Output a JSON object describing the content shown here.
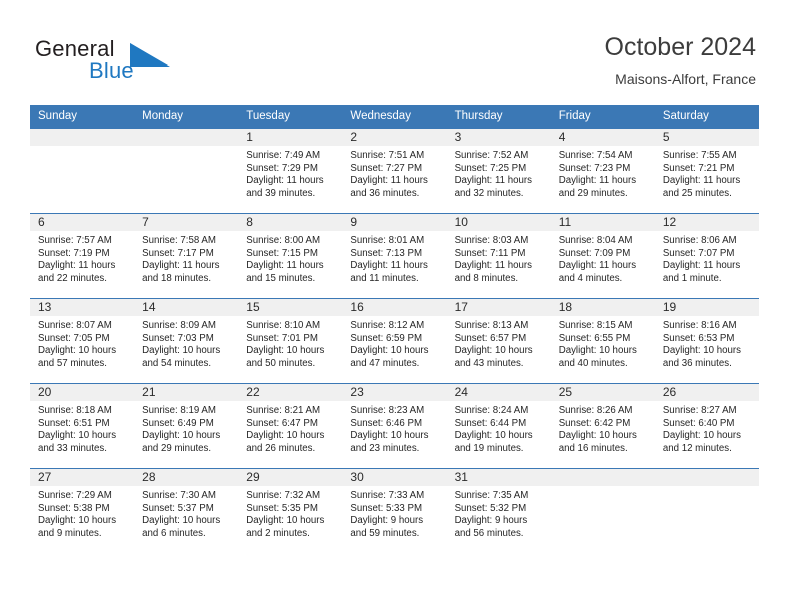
{
  "brand": {
    "name_part1": "General",
    "name_part2": "Blue",
    "logo_icon": "triangle-logo-icon",
    "color_dark": "#231f20",
    "color_blue": "#1f78c1"
  },
  "header": {
    "title": "October 2024",
    "subtitle": "Maisons-Alfort, France"
  },
  "theme": {
    "header_bg": "#3b78b5",
    "daynum_bg": "#f0f0f0",
    "grid_line": "#3b78b5"
  },
  "weekdays": [
    "Sunday",
    "Monday",
    "Tuesday",
    "Wednesday",
    "Thursday",
    "Friday",
    "Saturday"
  ],
  "weeks": [
    [
      {
        "day": "",
        "sunrise": "",
        "sunset": "",
        "daylight1": "",
        "daylight2": "",
        "empty": true
      },
      {
        "day": "",
        "sunrise": "",
        "sunset": "",
        "daylight1": "",
        "daylight2": "",
        "empty": true
      },
      {
        "day": "1",
        "sunrise": "Sunrise: 7:49 AM",
        "sunset": "Sunset: 7:29 PM",
        "daylight1": "Daylight: 11 hours",
        "daylight2": "and 39 minutes."
      },
      {
        "day": "2",
        "sunrise": "Sunrise: 7:51 AM",
        "sunset": "Sunset: 7:27 PM",
        "daylight1": "Daylight: 11 hours",
        "daylight2": "and 36 minutes."
      },
      {
        "day": "3",
        "sunrise": "Sunrise: 7:52 AM",
        "sunset": "Sunset: 7:25 PM",
        "daylight1": "Daylight: 11 hours",
        "daylight2": "and 32 minutes."
      },
      {
        "day": "4",
        "sunrise": "Sunrise: 7:54 AM",
        "sunset": "Sunset: 7:23 PM",
        "daylight1": "Daylight: 11 hours",
        "daylight2": "and 29 minutes."
      },
      {
        "day": "5",
        "sunrise": "Sunrise: 7:55 AM",
        "sunset": "Sunset: 7:21 PM",
        "daylight1": "Daylight: 11 hours",
        "daylight2": "and 25 minutes."
      }
    ],
    [
      {
        "day": "6",
        "sunrise": "Sunrise: 7:57 AM",
        "sunset": "Sunset: 7:19 PM",
        "daylight1": "Daylight: 11 hours",
        "daylight2": "and 22 minutes."
      },
      {
        "day": "7",
        "sunrise": "Sunrise: 7:58 AM",
        "sunset": "Sunset: 7:17 PM",
        "daylight1": "Daylight: 11 hours",
        "daylight2": "and 18 minutes."
      },
      {
        "day": "8",
        "sunrise": "Sunrise: 8:00 AM",
        "sunset": "Sunset: 7:15 PM",
        "daylight1": "Daylight: 11 hours",
        "daylight2": "and 15 minutes."
      },
      {
        "day": "9",
        "sunrise": "Sunrise: 8:01 AM",
        "sunset": "Sunset: 7:13 PM",
        "daylight1": "Daylight: 11 hours",
        "daylight2": "and 11 minutes."
      },
      {
        "day": "10",
        "sunrise": "Sunrise: 8:03 AM",
        "sunset": "Sunset: 7:11 PM",
        "daylight1": "Daylight: 11 hours",
        "daylight2": "and 8 minutes."
      },
      {
        "day": "11",
        "sunrise": "Sunrise: 8:04 AM",
        "sunset": "Sunset: 7:09 PM",
        "daylight1": "Daylight: 11 hours",
        "daylight2": "and 4 minutes."
      },
      {
        "day": "12",
        "sunrise": "Sunrise: 8:06 AM",
        "sunset": "Sunset: 7:07 PM",
        "daylight1": "Daylight: 11 hours",
        "daylight2": "and 1 minute."
      }
    ],
    [
      {
        "day": "13",
        "sunrise": "Sunrise: 8:07 AM",
        "sunset": "Sunset: 7:05 PM",
        "daylight1": "Daylight: 10 hours",
        "daylight2": "and 57 minutes."
      },
      {
        "day": "14",
        "sunrise": "Sunrise: 8:09 AM",
        "sunset": "Sunset: 7:03 PM",
        "daylight1": "Daylight: 10 hours",
        "daylight2": "and 54 minutes."
      },
      {
        "day": "15",
        "sunrise": "Sunrise: 8:10 AM",
        "sunset": "Sunset: 7:01 PM",
        "daylight1": "Daylight: 10 hours",
        "daylight2": "and 50 minutes."
      },
      {
        "day": "16",
        "sunrise": "Sunrise: 8:12 AM",
        "sunset": "Sunset: 6:59 PM",
        "daylight1": "Daylight: 10 hours",
        "daylight2": "and 47 minutes."
      },
      {
        "day": "17",
        "sunrise": "Sunrise: 8:13 AM",
        "sunset": "Sunset: 6:57 PM",
        "daylight1": "Daylight: 10 hours",
        "daylight2": "and 43 minutes."
      },
      {
        "day": "18",
        "sunrise": "Sunrise: 8:15 AM",
        "sunset": "Sunset: 6:55 PM",
        "daylight1": "Daylight: 10 hours",
        "daylight2": "and 40 minutes."
      },
      {
        "day": "19",
        "sunrise": "Sunrise: 8:16 AM",
        "sunset": "Sunset: 6:53 PM",
        "daylight1": "Daylight: 10 hours",
        "daylight2": "and 36 minutes."
      }
    ],
    [
      {
        "day": "20",
        "sunrise": "Sunrise: 8:18 AM",
        "sunset": "Sunset: 6:51 PM",
        "daylight1": "Daylight: 10 hours",
        "daylight2": "and 33 minutes."
      },
      {
        "day": "21",
        "sunrise": "Sunrise: 8:19 AM",
        "sunset": "Sunset: 6:49 PM",
        "daylight1": "Daylight: 10 hours",
        "daylight2": "and 29 minutes."
      },
      {
        "day": "22",
        "sunrise": "Sunrise: 8:21 AM",
        "sunset": "Sunset: 6:47 PM",
        "daylight1": "Daylight: 10 hours",
        "daylight2": "and 26 minutes."
      },
      {
        "day": "23",
        "sunrise": "Sunrise: 8:23 AM",
        "sunset": "Sunset: 6:46 PM",
        "daylight1": "Daylight: 10 hours",
        "daylight2": "and 23 minutes."
      },
      {
        "day": "24",
        "sunrise": "Sunrise: 8:24 AM",
        "sunset": "Sunset: 6:44 PM",
        "daylight1": "Daylight: 10 hours",
        "daylight2": "and 19 minutes."
      },
      {
        "day": "25",
        "sunrise": "Sunrise: 8:26 AM",
        "sunset": "Sunset: 6:42 PM",
        "daylight1": "Daylight: 10 hours",
        "daylight2": "and 16 minutes."
      },
      {
        "day": "26",
        "sunrise": "Sunrise: 8:27 AM",
        "sunset": "Sunset: 6:40 PM",
        "daylight1": "Daylight: 10 hours",
        "daylight2": "and 12 minutes."
      }
    ],
    [
      {
        "day": "27",
        "sunrise": "Sunrise: 7:29 AM",
        "sunset": "Sunset: 5:38 PM",
        "daylight1": "Daylight: 10 hours",
        "daylight2": "and 9 minutes."
      },
      {
        "day": "28",
        "sunrise": "Sunrise: 7:30 AM",
        "sunset": "Sunset: 5:37 PM",
        "daylight1": "Daylight: 10 hours",
        "daylight2": "and 6 minutes."
      },
      {
        "day": "29",
        "sunrise": "Sunrise: 7:32 AM",
        "sunset": "Sunset: 5:35 PM",
        "daylight1": "Daylight: 10 hours",
        "daylight2": "and 2 minutes."
      },
      {
        "day": "30",
        "sunrise": "Sunrise: 7:33 AM",
        "sunset": "Sunset: 5:33 PM",
        "daylight1": "Daylight: 9 hours",
        "daylight2": "and 59 minutes."
      },
      {
        "day": "31",
        "sunrise": "Sunrise: 7:35 AM",
        "sunset": "Sunset: 5:32 PM",
        "daylight1": "Daylight: 9 hours",
        "daylight2": "and 56 minutes."
      },
      {
        "day": "",
        "sunrise": "",
        "sunset": "",
        "daylight1": "",
        "daylight2": "",
        "empty": true
      },
      {
        "day": "",
        "sunrise": "",
        "sunset": "",
        "daylight1": "",
        "daylight2": "",
        "empty": true
      }
    ]
  ]
}
